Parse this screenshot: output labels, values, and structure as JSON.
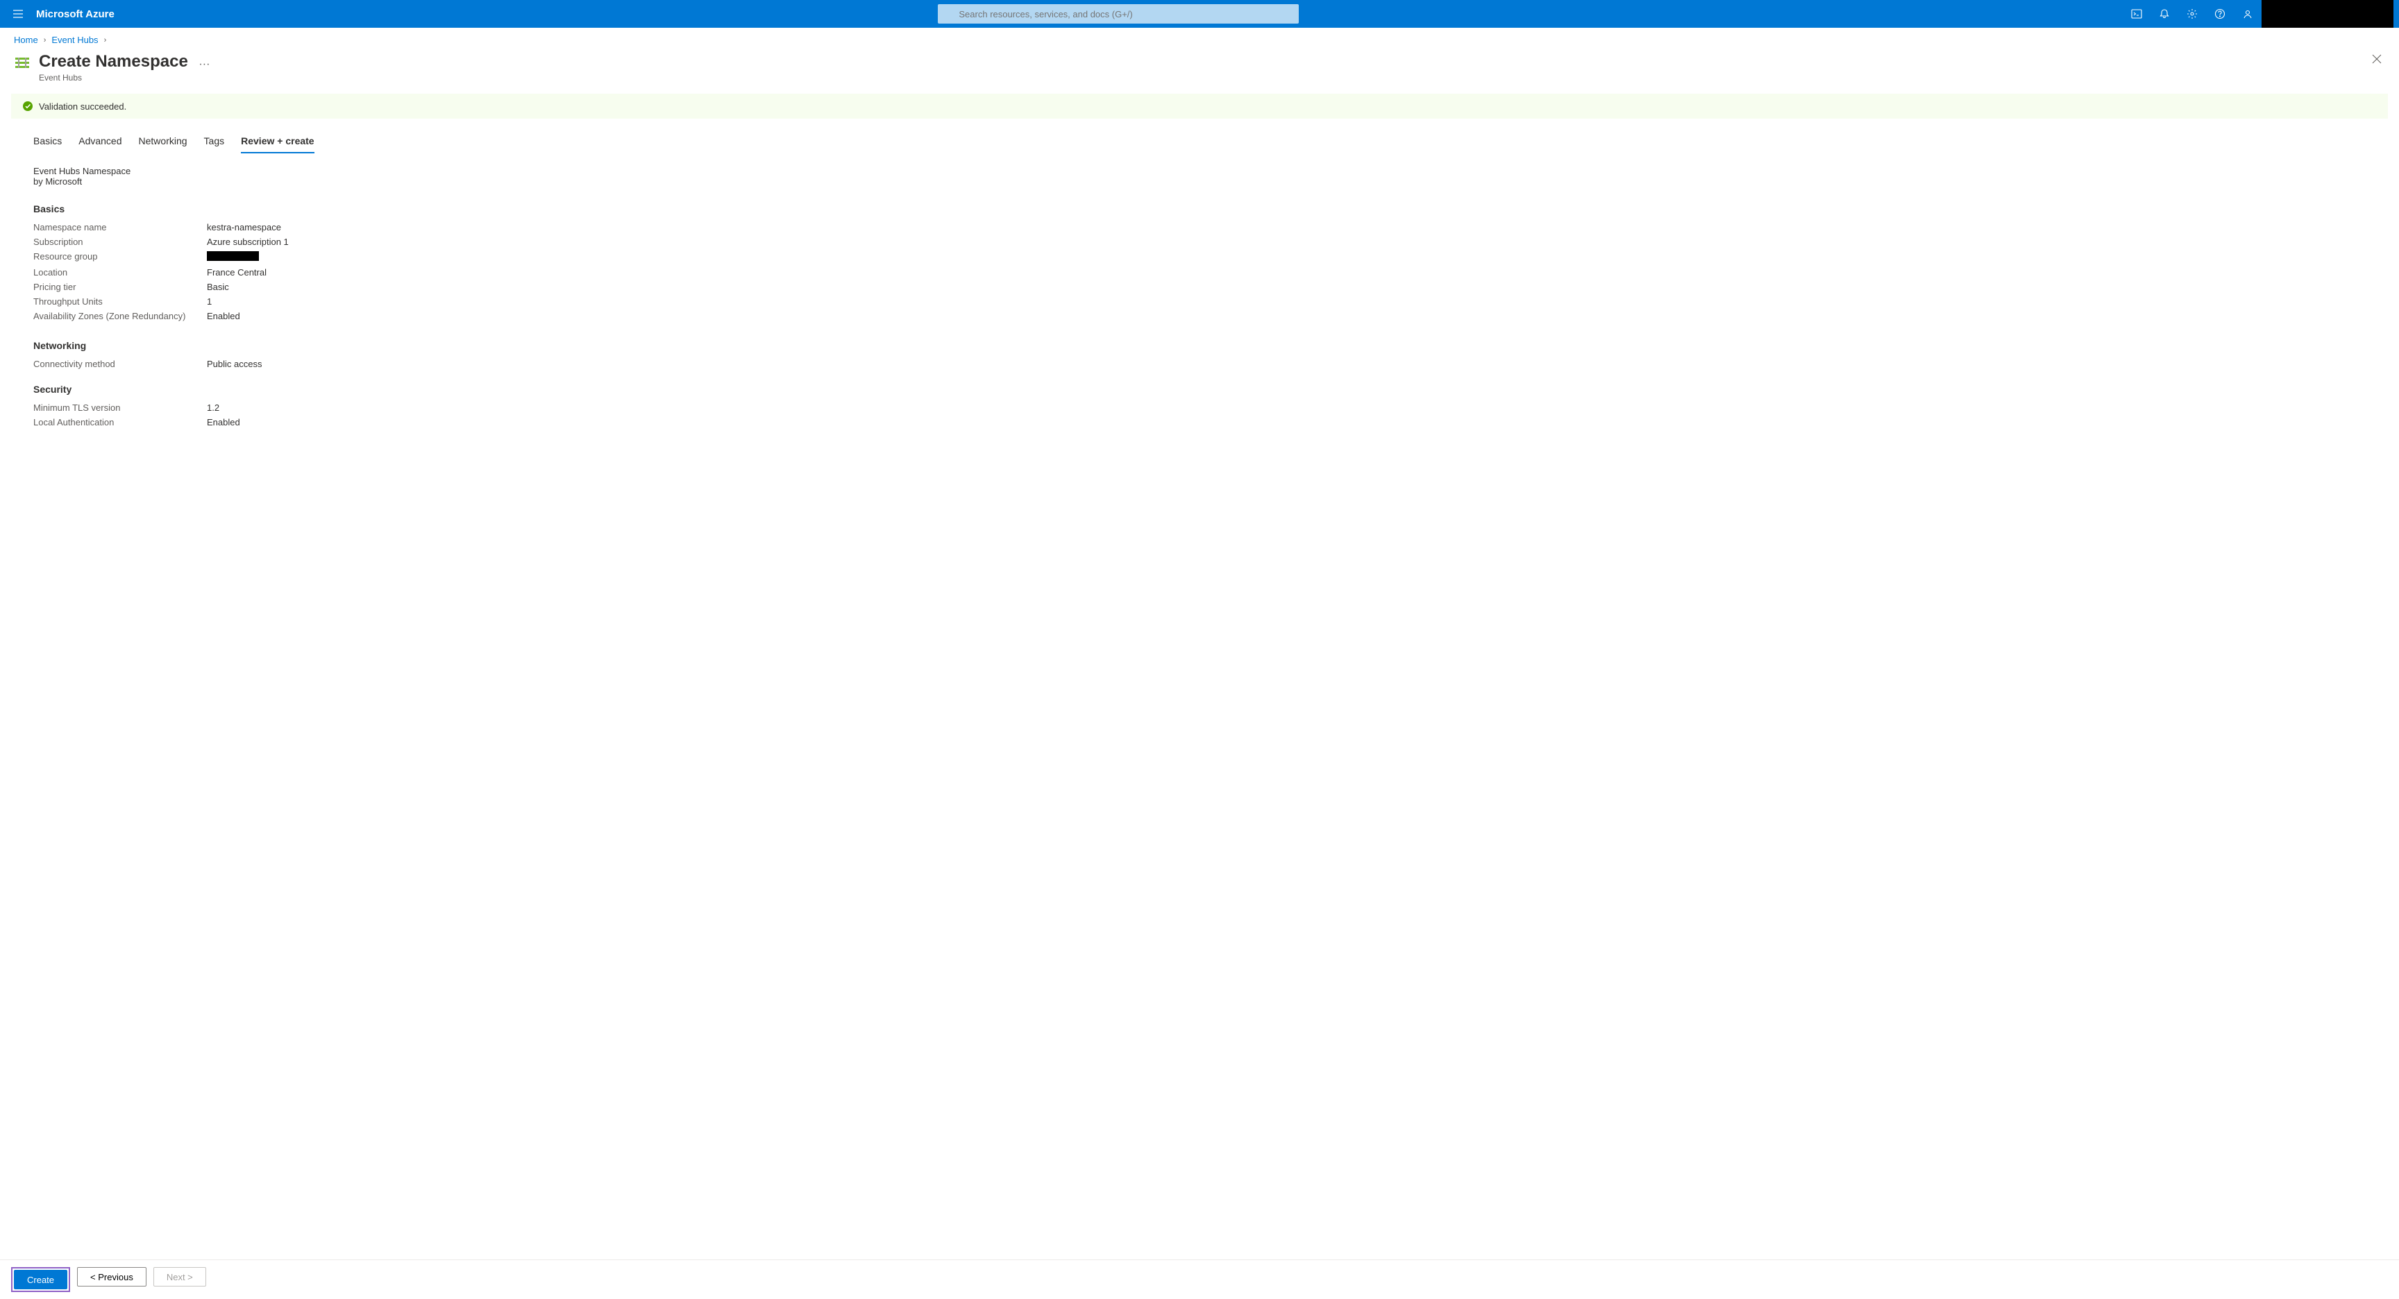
{
  "header": {
    "brand": "Microsoft Azure",
    "search_placeholder": "Search resources, services, and docs (G+/)"
  },
  "breadcrumb": {
    "home": "Home",
    "event_hubs": "Event Hubs"
  },
  "page": {
    "title": "Create Namespace",
    "subtitle": "Event Hubs"
  },
  "validation": {
    "message": "Validation succeeded."
  },
  "tabs": {
    "basics": "Basics",
    "advanced": "Advanced",
    "networking": "Networking",
    "tags": "Tags",
    "review_create": "Review + create"
  },
  "meta": {
    "line1": "Event Hubs Namespace",
    "line2": "by Microsoft"
  },
  "sections": {
    "basics": {
      "heading": "Basics",
      "namespace_name": {
        "label": "Namespace name",
        "value": "kestra-namespace"
      },
      "subscription": {
        "label": "Subscription",
        "value": "Azure subscription 1"
      },
      "resource_group": {
        "label": "Resource group",
        "value": ""
      },
      "location": {
        "label": "Location",
        "value": "France Central"
      },
      "pricing_tier": {
        "label": "Pricing tier",
        "value": "Basic"
      },
      "throughput_units": {
        "label": "Throughput Units",
        "value": "1"
      },
      "availability_zones": {
        "label": "Availability Zones (Zone Redundancy)",
        "value": "Enabled"
      }
    },
    "networking": {
      "heading": "Networking",
      "connectivity": {
        "label": "Connectivity method",
        "value": "Public access"
      }
    },
    "security": {
      "heading": "Security",
      "min_tls": {
        "label": "Minimum TLS version",
        "value": "1.2"
      },
      "local_auth": {
        "label": "Local Authentication",
        "value": "Enabled"
      }
    }
  },
  "footer": {
    "create": "Create",
    "previous": "< Previous",
    "next": "Next >"
  }
}
